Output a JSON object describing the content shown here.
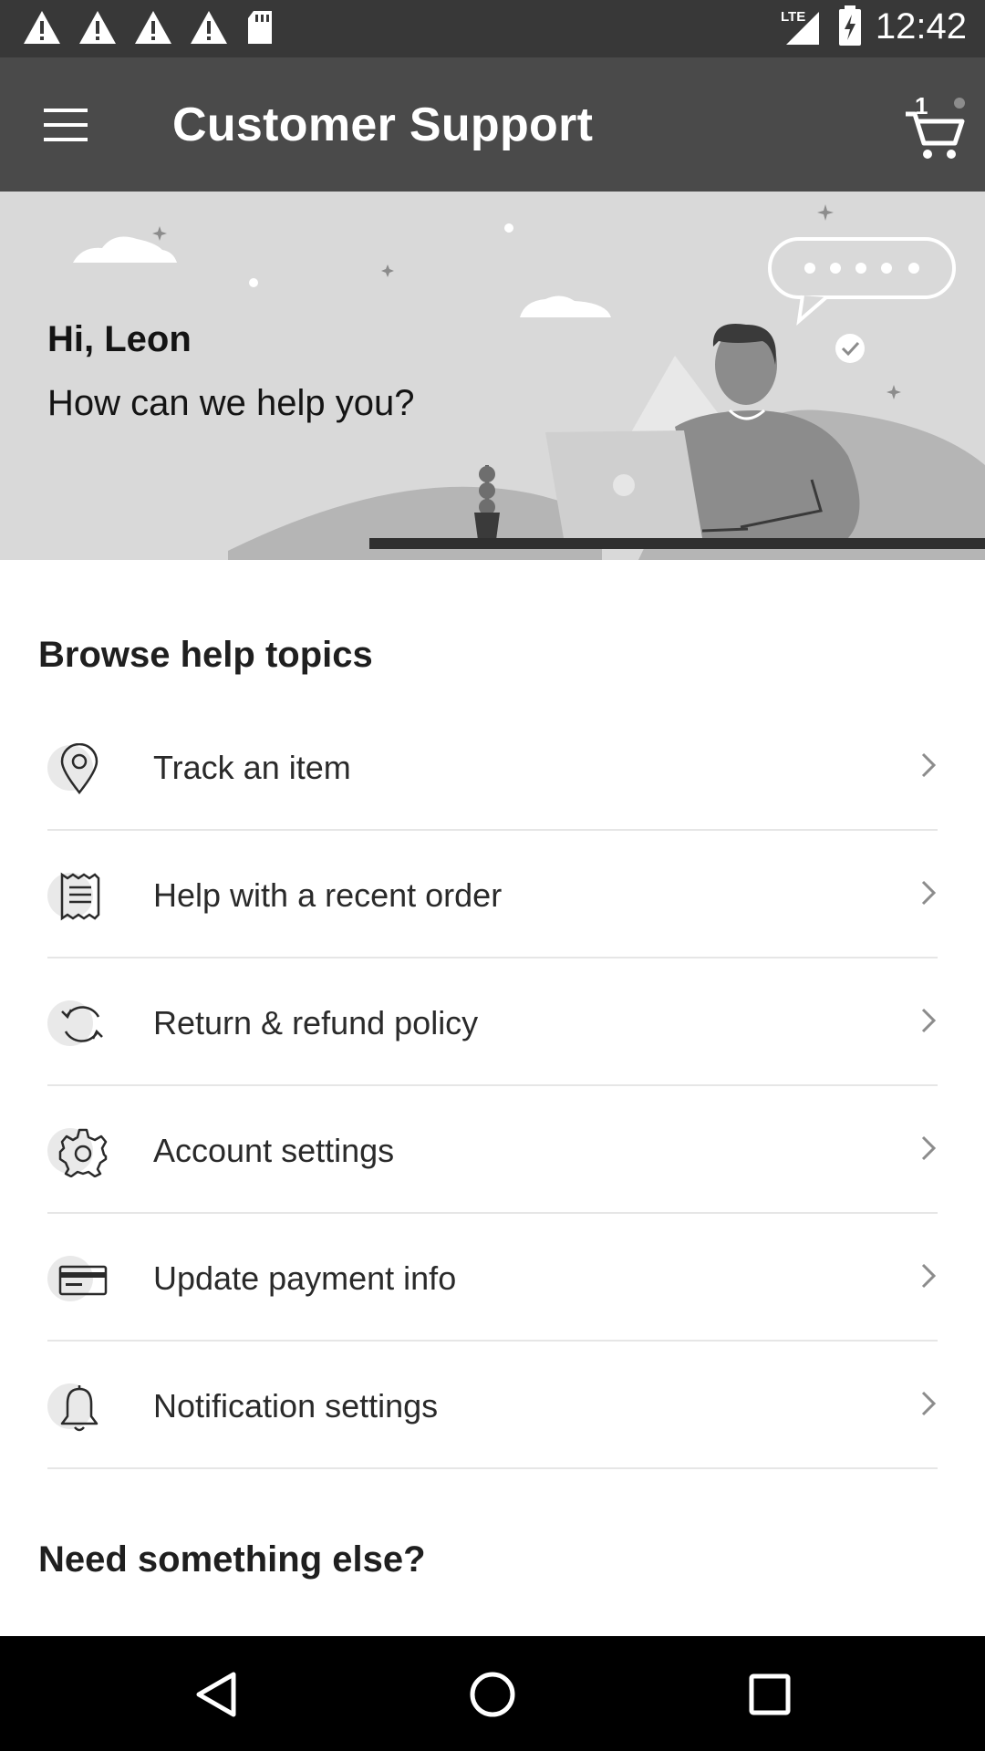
{
  "status_bar": {
    "time": "12:42",
    "network": "LTE",
    "left_icons": [
      "warning-icon",
      "warning-icon",
      "warning-icon",
      "warning-icon",
      "sd-card-icon"
    ],
    "right_icons": [
      "lte-signal-icon",
      "battery-charging-icon"
    ]
  },
  "toolbar": {
    "title": "Customer Support",
    "cart_count": "1"
  },
  "hero": {
    "greeting": "Hi, Leon",
    "subgreeting": "How can we help you?"
  },
  "browse": {
    "title": "Browse help topics",
    "topics": [
      {
        "label": "Track an item",
        "icon": "location-pin-icon"
      },
      {
        "label": "Help with a recent order",
        "icon": "receipt-icon"
      },
      {
        "label": "Return & refund policy",
        "icon": "refresh-icon"
      },
      {
        "label": "Account settings",
        "icon": "gear-icon"
      },
      {
        "label": "Update payment info",
        "icon": "credit-card-icon"
      },
      {
        "label": "Notification settings",
        "icon": "bell-icon"
      }
    ]
  },
  "more": {
    "title": "Need something else?"
  },
  "nav_bar": {
    "icons": [
      "back-icon",
      "home-icon",
      "recents-icon"
    ]
  },
  "colors": {
    "status_bar": "#383838",
    "toolbar": "#4a4a4a",
    "hero_bg": "#d9d9d9",
    "divider": "#e6e6e6"
  }
}
